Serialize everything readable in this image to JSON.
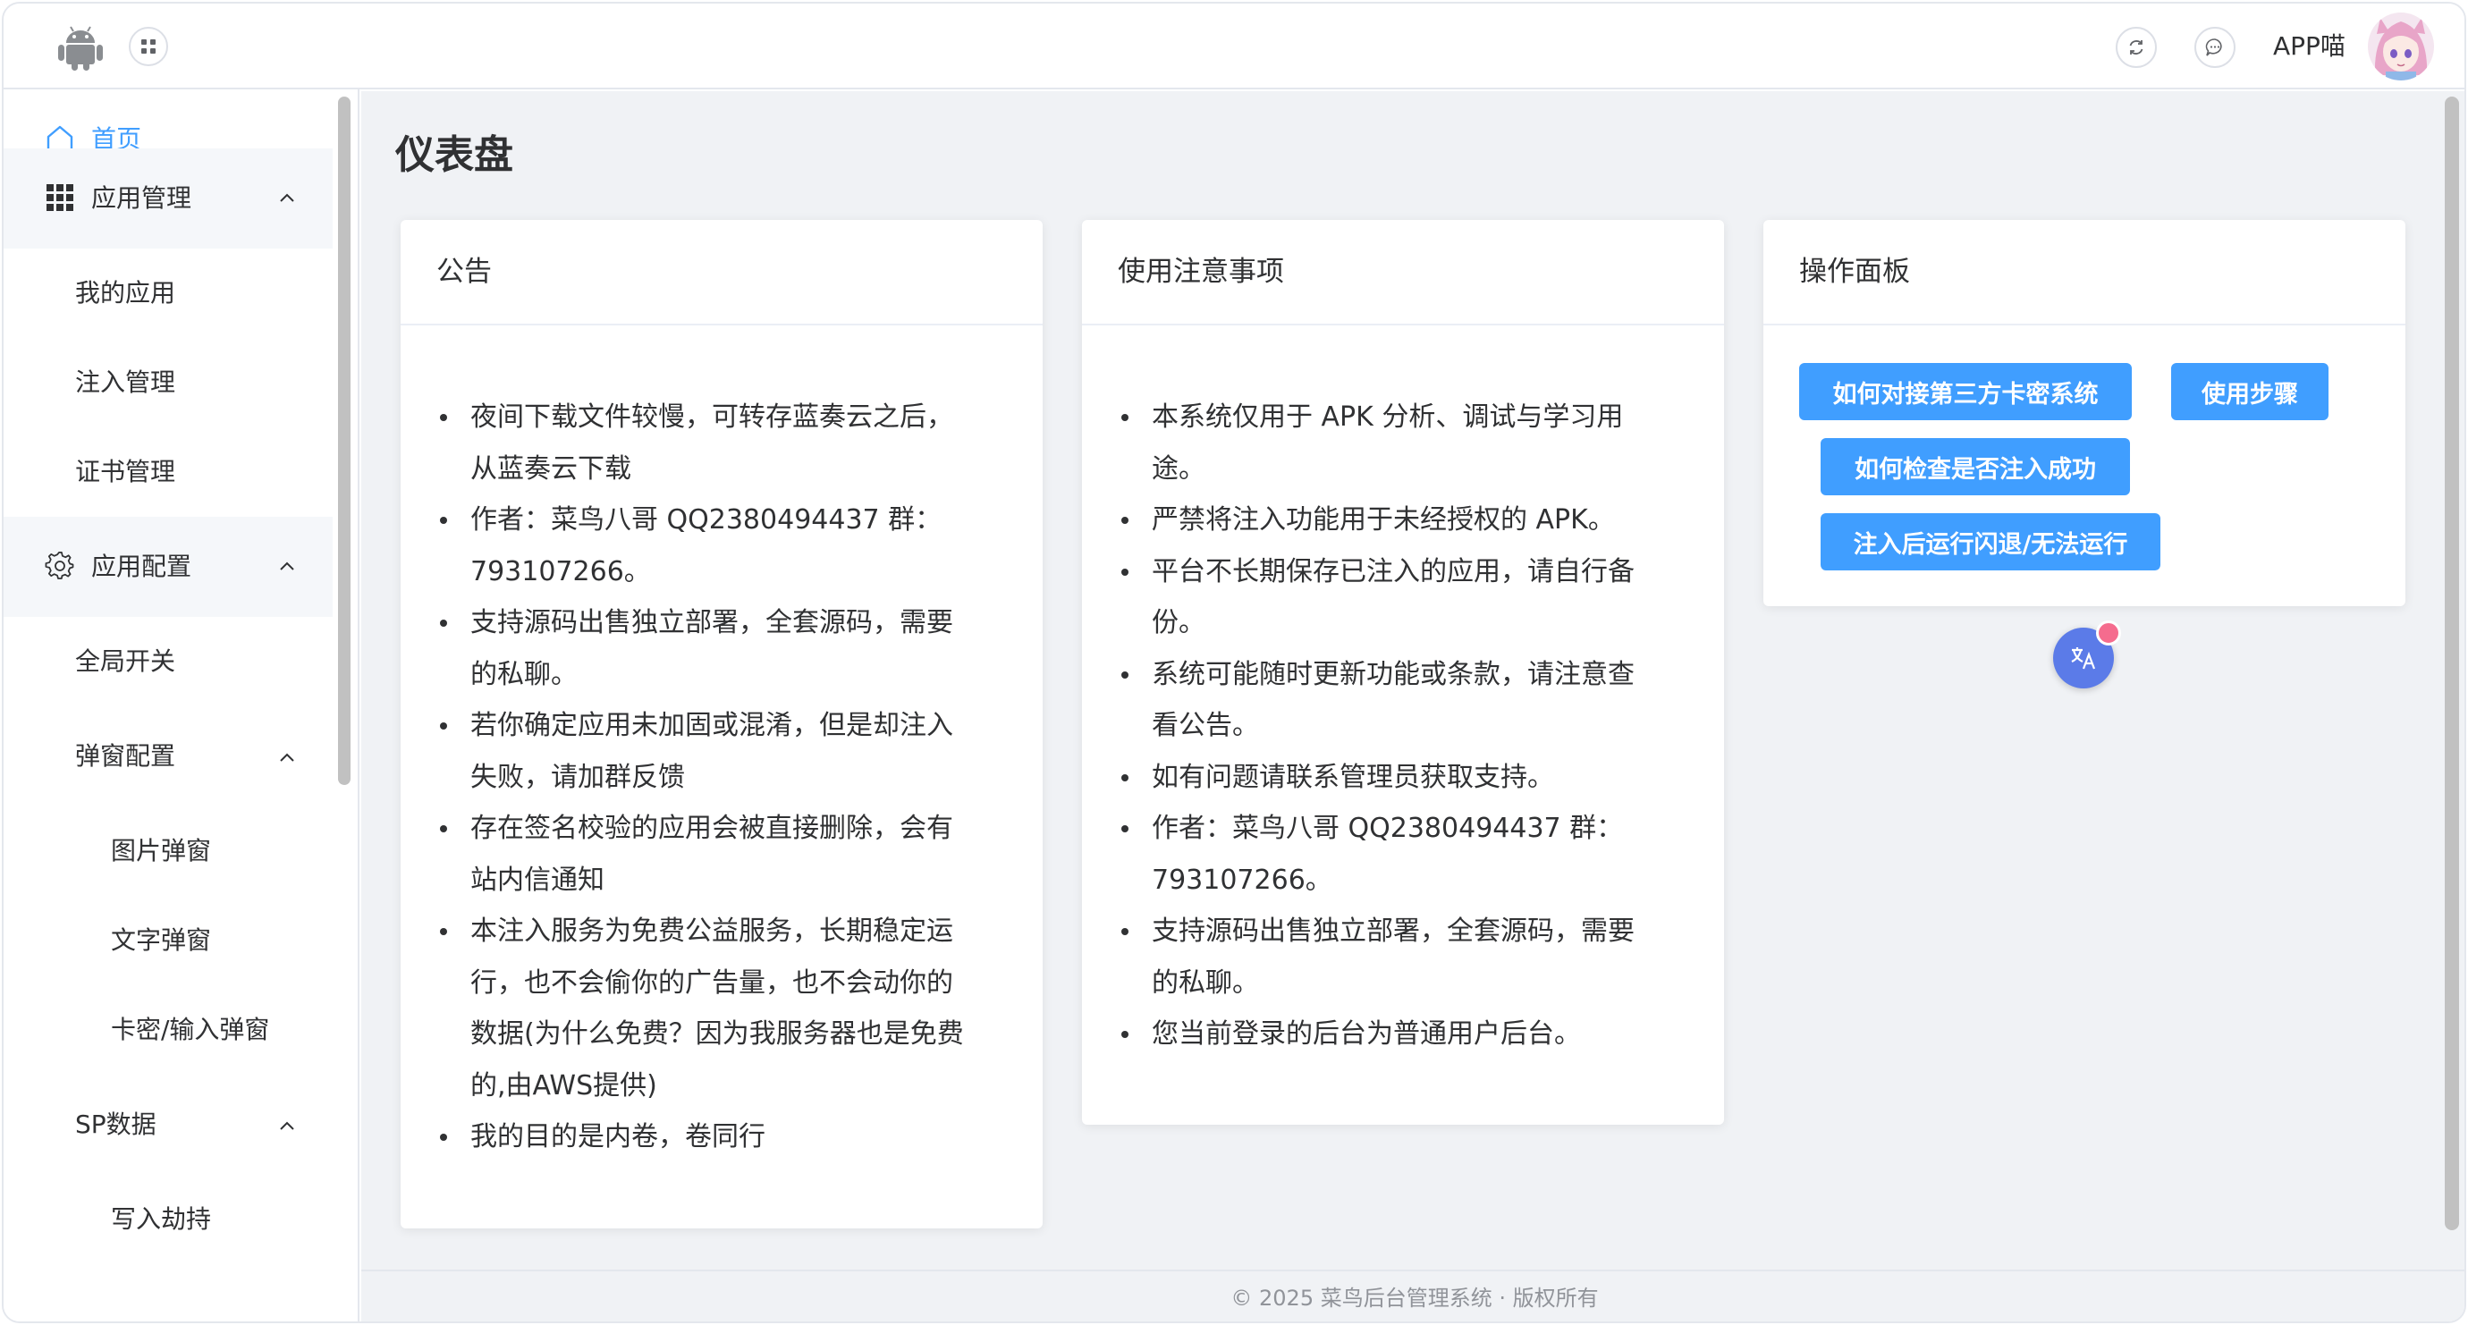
{
  "header": {
    "username": "APP喵"
  },
  "sidebar": {
    "home": "首页",
    "app_management": "应用管理",
    "my_apps": "我的应用",
    "injection_management": "注入管理",
    "certificate_management": "证书管理",
    "app_config": "应用配置",
    "global_switch": "全局开关",
    "popup_config": "弹窗配置",
    "image_popup": "图片弹窗",
    "text_popup": "文字弹窗",
    "card_input_popup": "卡密/输入弹窗",
    "sp_data": "SP数据",
    "write_hijack": "写入劫持"
  },
  "main": {
    "title": "仪表盘"
  },
  "announcement": {
    "title": "公告",
    "items": [
      [
        "夜间下载文件较慢，可转存蓝奏云之后，",
        "从蓝奏云下载"
      ],
      [
        "作者：菜鸟八哥 QQ2380494437 群：",
        "793107266。"
      ],
      [
        "支持源码出售独立部署，全套源码，需要",
        "的私聊。"
      ],
      [
        "若你确定应用未加固或混淆，但是却注入",
        "失败，请加群反馈"
      ],
      [
        "存在签名校验的应用会被直接删除，会有",
        "站内信通知"
      ],
      [
        "本注入服务为免费公益服务，长期稳定运",
        "行，也不会偷你的广告量，也不会动你的",
        "数据(为什么免费？因为我服务器也是免费",
        "的,由AWS提供)"
      ],
      [
        "我的目的是内卷，卷同行"
      ]
    ]
  },
  "notes": {
    "title": "使用注意事项",
    "items": [
      [
        "本系统仅用于 APK 分析、调试与学习用",
        "途。"
      ],
      [
        "严禁将注入功能用于未经授权的 APK。"
      ],
      [
        "平台不长期保存已注入的应用，请自行备",
        "份。"
      ],
      [
        "系统可能随时更新功能或条款，请注意查",
        "看公告。"
      ],
      [
        "如有问题请联系管理员获取支持。"
      ],
      [
        "作者：菜鸟八哥 QQ2380494437 群：",
        "793107266。"
      ],
      [
        "支持源码出售独立部署，全套源码，需要",
        "的私聊。"
      ],
      [
        "您当前登录的后台为普通用户后台。"
      ]
    ]
  },
  "panel": {
    "title": "操作面板",
    "btn_third_party": "如何对接第三方卡密系统",
    "btn_steps": "使用步骤",
    "btn_check": "如何检查是否注入成功",
    "btn_crash": "注入后运行闪退/无法运行"
  },
  "footer": {
    "text": "© 2025 菜鸟后台管理系统 · 版权所有"
  },
  "colors": {
    "primary": "#409eff",
    "background": "#f0f2f5"
  }
}
